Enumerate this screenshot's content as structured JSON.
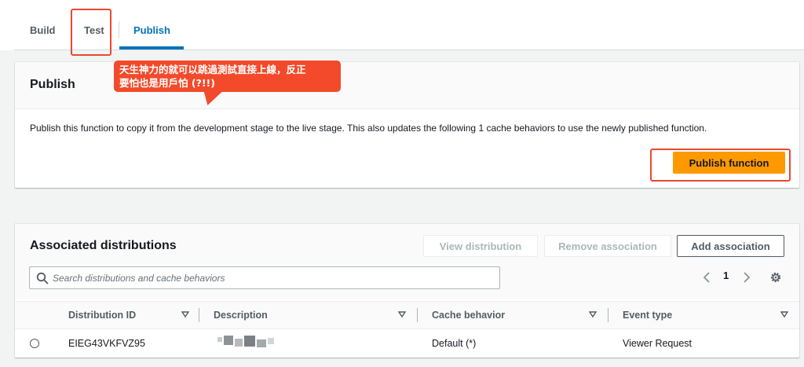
{
  "tabs": [
    {
      "label": "Build"
    },
    {
      "label": "Test"
    },
    {
      "label": "Publish"
    }
  ],
  "callout": {
    "line1": "天生神力的就可以跳過測試直接上線，反正",
    "line2": "要怕也是用戶怕 (?!!)"
  },
  "publish": {
    "title": "Publish",
    "description": "Publish this function to copy it from the development stage to the live stage. This also updates the following 1 cache behaviors to use the newly published function.",
    "button_label": "Publish function"
  },
  "distributions": {
    "title": "Associated distributions",
    "buttons": {
      "view": "View distribution",
      "remove": "Remove association",
      "add": "Add association"
    },
    "search_placeholder": "Search distributions and cache behaviors",
    "page": "1",
    "columns": [
      "Distribution ID",
      "Description",
      "Cache behavior",
      "Event type"
    ],
    "rows": [
      {
        "id": "EIEG43VKFVZ95",
        "description": "",
        "cache_behavior": "Default (*)",
        "event_type": "Viewer Request"
      }
    ]
  },
  "colors": {
    "accent": "#0073bb",
    "primary_button": "#ff9900",
    "annotation": "#e8492e"
  },
  "icons": [
    "search-icon",
    "chevron-left-icon",
    "chevron-right-icon",
    "gear-icon",
    "sort-down-icon"
  ]
}
